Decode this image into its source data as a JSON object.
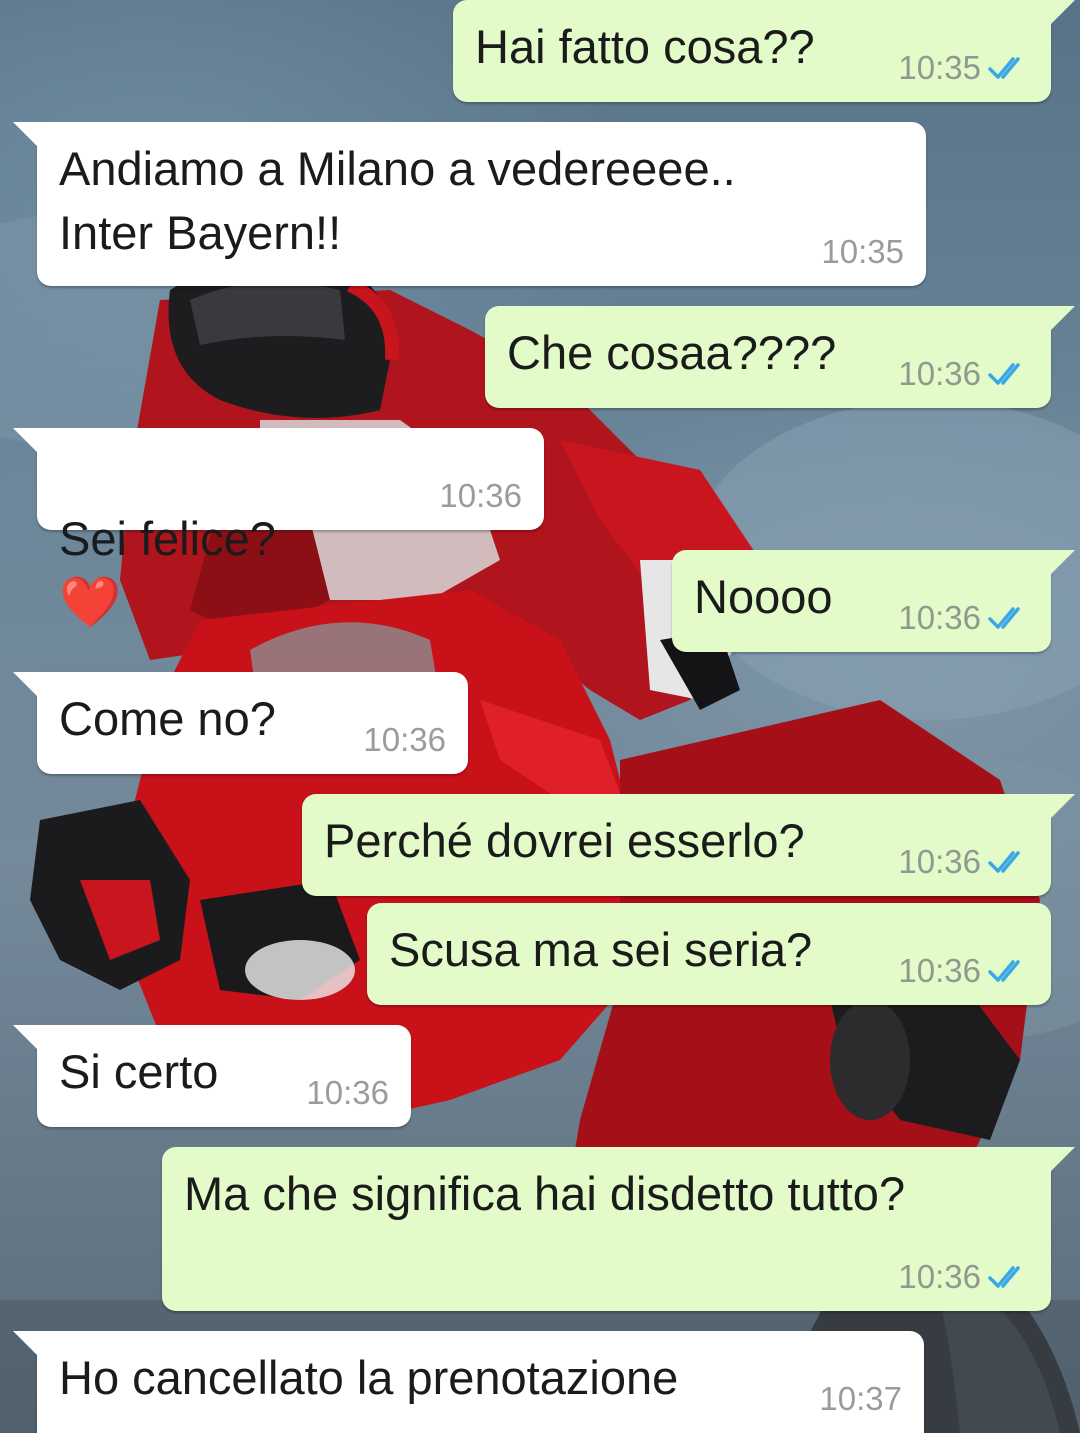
{
  "theme": {
    "outgoing_bubble": "#e2fbc8",
    "incoming_bubble": "#ffffff",
    "read_ticks": "#3aa8e6",
    "timestamp": "#8e9a90"
  },
  "wallpaper": {
    "subject": "motorcycle-rider-photo"
  },
  "messages": [
    {
      "direction": "outgoing",
      "text": "Hai fatto cosa??",
      "time": "10:35",
      "status_icon": "double-check-read-icon"
    },
    {
      "direction": "incoming",
      "text": "Andiamo a Milano a vedereeee..\nInter Bayern!!",
      "time": "10:35"
    },
    {
      "direction": "outgoing",
      "text": "Che cosaa????",
      "time": "10:36",
      "status_icon": "double-check-read-icon"
    },
    {
      "direction": "incoming",
      "text": "Sei felice?",
      "emoji": "❤️",
      "emoji_name": "red-heart-icon",
      "time": "10:36"
    },
    {
      "direction": "outgoing",
      "text": "Noooo",
      "time": "10:36",
      "status_icon": "double-check-read-icon"
    },
    {
      "direction": "incoming",
      "text": "Come no?",
      "time": "10:36"
    },
    {
      "direction": "outgoing",
      "text": "Perché dovrei esserlo?",
      "time": "10:36",
      "status_icon": "double-check-read-icon"
    },
    {
      "direction": "outgoing",
      "text": "Scusa ma sei seria?",
      "time": "10:36",
      "status_icon": "double-check-read-icon"
    },
    {
      "direction": "incoming",
      "text": "Si certo",
      "time": "10:36"
    },
    {
      "direction": "outgoing",
      "text": "Ma che significa hai disdetto tutto?",
      "time": "10:36",
      "status_icon": "double-check-read-icon"
    },
    {
      "direction": "incoming",
      "text": "Ho cancellato la prenotazione",
      "time": "10:37"
    }
  ]
}
